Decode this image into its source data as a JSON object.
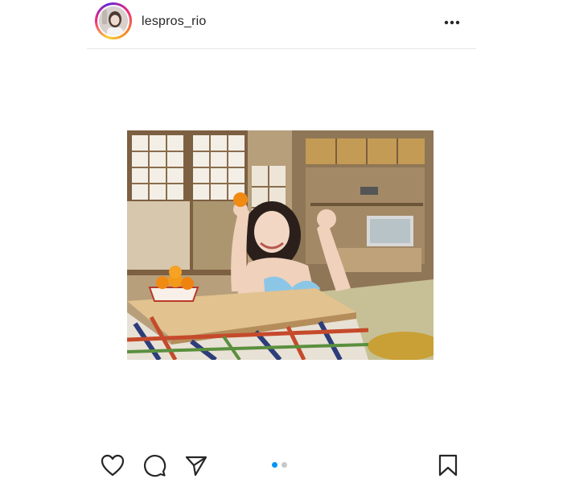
{
  "post": {
    "username": "lespros_rio",
    "carousel": {
      "count": 2,
      "active": 1
    }
  },
  "icons": {
    "more": "more-options-icon",
    "like": "heart-icon",
    "comment": "comment-icon",
    "share": "paper-plane-icon",
    "save": "bookmark-icon"
  },
  "colors": {
    "text": "#262626",
    "divider": "#e6e6e6",
    "active_dot": "#0095f6",
    "inactive_dot": "#c8c8c8"
  }
}
